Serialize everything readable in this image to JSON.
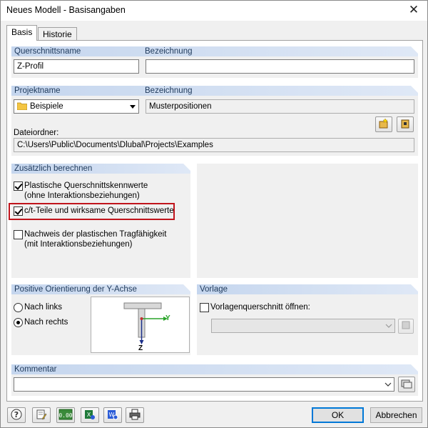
{
  "window": {
    "title": "Neues Modell - Basisangaben",
    "close_label": "✕"
  },
  "tabs": [
    {
      "label": "Basis",
      "active": true
    },
    {
      "label": "Historie",
      "active": false
    }
  ],
  "querschnitt": {
    "name_header": "Querschnittsname",
    "name_value": "Z-Profil",
    "bez_header": "Bezeichnung",
    "bez_value": ""
  },
  "projekt": {
    "name_header": "Projektname",
    "name_value": "Beispiele",
    "bez_header": "Bezeichnung",
    "bez_value": "Musterpositionen",
    "folder_label": "Dateiordner:",
    "folder_value": "C:\\Users\\Public\\Documents\\Dlubal\\Projects\\Examples"
  },
  "zusaetzlich": {
    "header": "Zusätzlich berechnen",
    "items": [
      {
        "line1": "Plastische Querschnittskennwerte",
        "line2": "(ohne Interaktionsbeziehungen)",
        "checked": true
      },
      {
        "line1": "c/t-Teile und wirksame Querschnittswerte",
        "line2": "",
        "checked": true
      },
      {
        "line1": "Nachweis der plastischen Tragfähigkeit",
        "line2": "(mit Interaktionsbeziehungen)",
        "checked": false
      }
    ]
  },
  "orientierung": {
    "header": "Positive Orientierung der Y-Achse",
    "options": [
      {
        "label": "Nach links",
        "checked": false
      },
      {
        "label": "Nach rechts",
        "checked": true
      }
    ],
    "axis_y": "Y",
    "axis_z": "Z",
    "axis_color": "#28a428"
  },
  "vorlage": {
    "header": "Vorlage",
    "checkbox_label": "Vorlagenquerschnitt öffnen:",
    "checked": false
  },
  "kommentar": {
    "header": "Kommentar",
    "value": ""
  },
  "footer": {
    "ok_label": "OK",
    "cancel_label": "Abbrechen"
  },
  "colors": {
    "header_bg": "#c5d6ee",
    "header_text": "#1e395b",
    "highlight": "#c0141c"
  }
}
